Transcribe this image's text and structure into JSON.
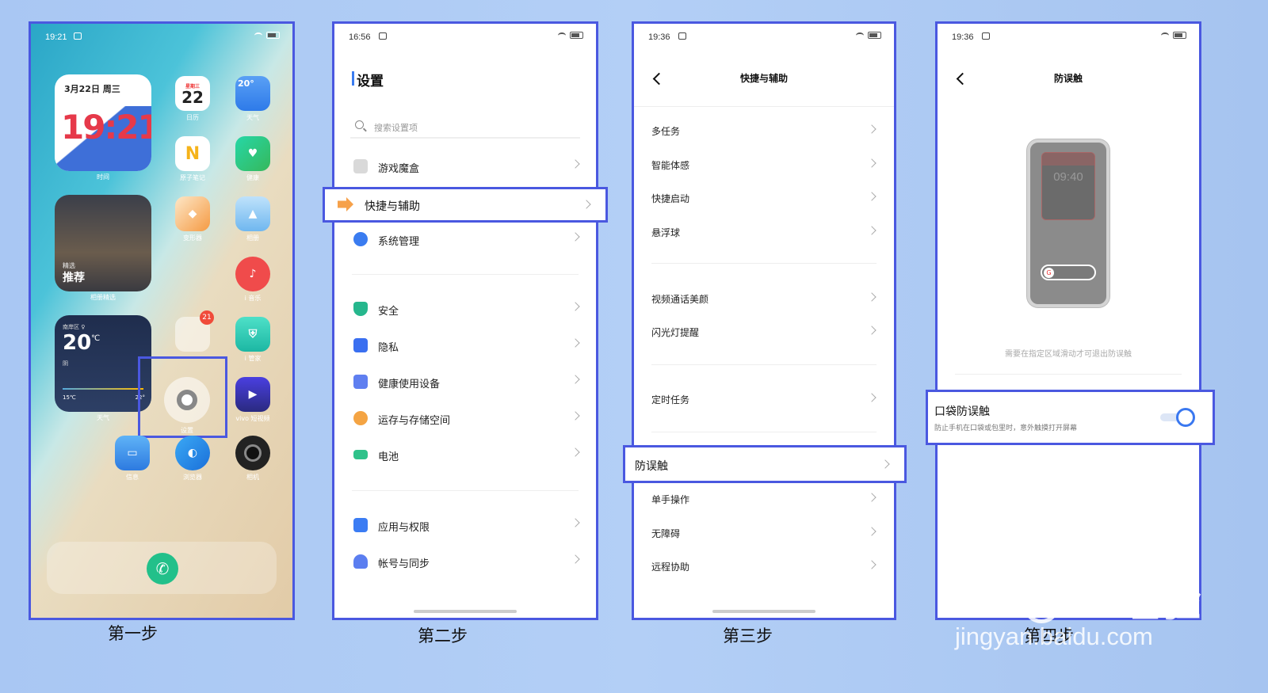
{
  "steps": {
    "s1": "第一步",
    "s2": "第二步",
    "s3": "第三步",
    "s4": "第四步"
  },
  "phone1": {
    "time": "19:21",
    "date_widget": {
      "date": "3月22日 周三",
      "clock": "19:21",
      "label": "时间"
    },
    "calendar": {
      "weekday": "星期三",
      "day": "22",
      "label": "日历"
    },
    "weather_icon": {
      "temp": "20°",
      "label": "天气"
    },
    "notes_label": "原子笔记",
    "health_label": "健康",
    "cube_label": "变形器",
    "gallery_label": "相册",
    "photo_widget": {
      "small": "精选",
      "big": "推荐",
      "label": "相册精选"
    },
    "music_label": "i 音乐",
    "folder_badge": "21",
    "manager_label": "i 管家",
    "weather_widget": {
      "place": "南岸区 ♀",
      "temp": "20",
      "unit": "℃",
      "cond": "阴",
      "low": "15℃",
      "high": "22°",
      "label": "天气"
    },
    "settings_label": "设置",
    "video_label": "vivo 短视频",
    "msg_label": "信息",
    "browser_label": "浏览器",
    "camera_label": "相机"
  },
  "phone2": {
    "time": "16:56",
    "title": "设置",
    "search_placeholder": "搜索设置项",
    "items": [
      {
        "label": "游戏魔盒",
        "color": "#d9d9d9"
      },
      {
        "label": "快捷与辅助",
        "color": "#f6a14a"
      },
      {
        "label": "系统管理",
        "color": "#3a7cf0"
      },
      {
        "label": "安全",
        "color": "#26b78d"
      },
      {
        "label": "隐私",
        "color": "#3a6ff0"
      },
      {
        "label": "健康使用设备",
        "color": "#5f7ff0"
      },
      {
        "label": "运存与存储空间",
        "color": "#f4a443"
      },
      {
        "label": "电池",
        "color": "#2fc28a"
      },
      {
        "label": "应用与权限",
        "color": "#3b7cf3"
      },
      {
        "label": "帐号与同步",
        "color": "#5b7ef0"
      }
    ]
  },
  "phone3": {
    "time": "19:36",
    "title": "快捷与辅助",
    "items": [
      "多任务",
      "智能体感",
      "快捷启动",
      "悬浮球",
      "视频通话美颜",
      "闪光灯提醒",
      "定时任务",
      "防误触",
      "单手操作",
      "无障碍",
      "远程协助"
    ]
  },
  "phone4": {
    "time": "19:36",
    "title": "防误触",
    "mock_clock": "09:40",
    "hint": "需要在指定区域滑动才可退出防误触",
    "option_title": "口袋防误触",
    "option_desc": "防止手机在口袋或包里时，意外触摸打开屏幕",
    "toggle_on": true
  },
  "watermark": {
    "brand": "Bai",
    "brand2": "du",
    "cn": "经验",
    "url": "jingyan.baidu.com"
  }
}
